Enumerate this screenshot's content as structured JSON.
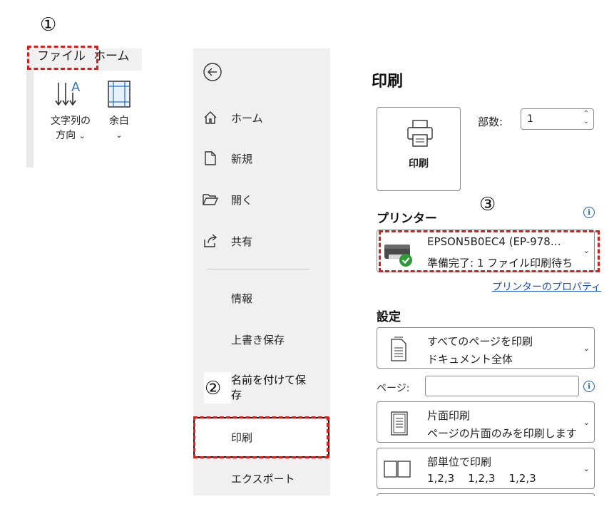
{
  "annotations": {
    "step1": "①",
    "step2": "②",
    "step3": "③",
    "highlight_color": "#d52020"
  },
  "ribbon": {
    "tabs": [
      "ファイル",
      "ホーム"
    ],
    "text_direction_label_line1": "文字列の",
    "text_direction_label_line2": "方向",
    "margins_label": "余白",
    "dropdown_glyph": "⌄"
  },
  "backstage_nav": {
    "back_icon": "arrow-left-circle-icon",
    "items": [
      {
        "label": "ホーム",
        "icon": "home-icon"
      },
      {
        "label": "新規",
        "icon": "new-document-icon"
      },
      {
        "label": "開く",
        "icon": "open-folder-icon"
      },
      {
        "label": "共有",
        "icon": "share-icon"
      },
      {
        "label": "情報"
      },
      {
        "label": "上書き保存"
      },
      {
        "label": "名前を付けて保存"
      },
      {
        "label": "印刷",
        "selected": true
      },
      {
        "label": "エクスポート"
      }
    ],
    "save_as_line1": "名前を付けて保",
    "save_as_line2": "存"
  },
  "print_pane": {
    "title": "印刷",
    "print_button_label": "印刷",
    "copies_label": "部数:",
    "copies_value": "1",
    "printer_heading": "プリンター",
    "printer": {
      "name": "EPSON5B0EC4 (EP-978…",
      "status": "準備完了: 1 ファイル印刷待ち"
    },
    "printer_properties_link": "プリンターのプロパティ",
    "settings_heading": "設定",
    "settings": [
      {
        "line1": "すべてのページを印刷",
        "line2": "ドキュメント全体",
        "icon": "all-pages-icon"
      },
      {
        "line1": "片面印刷",
        "line2": "ページの片面のみを印刷します",
        "icon": "one-sided-icon"
      },
      {
        "line1": "部単位で印刷",
        "line2": "1,2,3    1,2,3    1,2,3",
        "icon": "collated-icon"
      }
    ],
    "pages_label": "ページ:",
    "pages_value": "",
    "info_glyph": "i"
  }
}
